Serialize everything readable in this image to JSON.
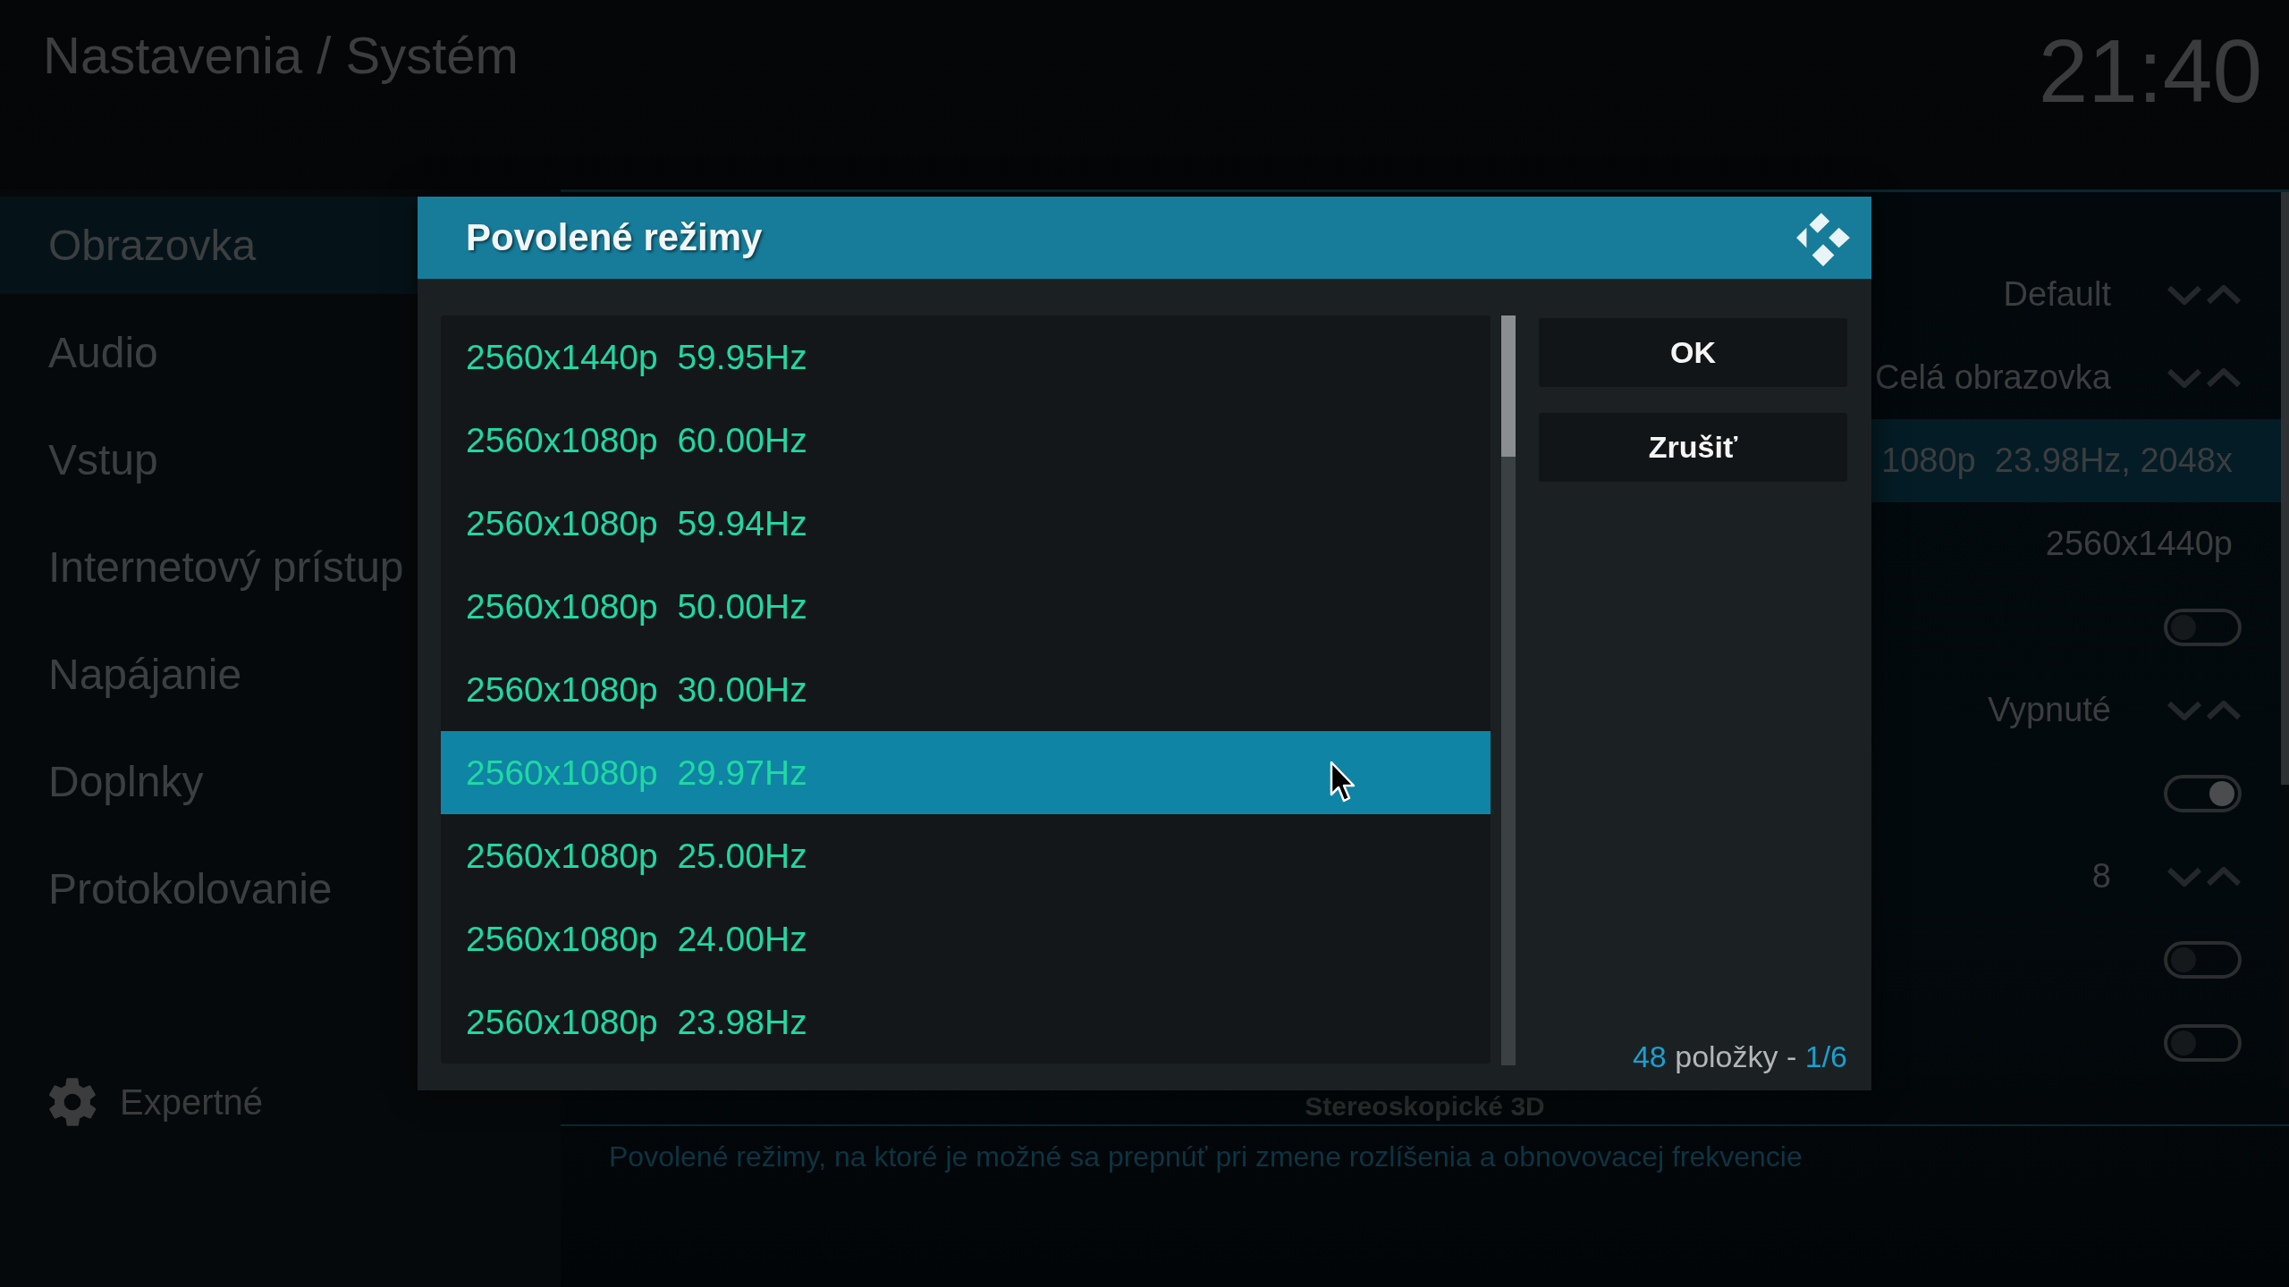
{
  "header": {
    "title": "Nastavenia / Systém",
    "clock": "21:40"
  },
  "sidebar": {
    "items": [
      {
        "label": "Obrazovka",
        "selected": true
      },
      {
        "label": "Audio",
        "selected": false
      },
      {
        "label": "Vstup",
        "selected": false
      },
      {
        "label": "Internetový prístup",
        "selected": false
      },
      {
        "label": "Napájanie",
        "selected": false
      },
      {
        "label": "Doplnky",
        "selected": false
      },
      {
        "label": "Protokolovanie",
        "selected": false
      }
    ],
    "level_button": {
      "label": "Expertné"
    }
  },
  "settings": {
    "rows": [
      {
        "kind": "spinner",
        "value": "Default",
        "selected": false
      },
      {
        "kind": "spinner",
        "value": "Celá obrazovka",
        "selected": false
      },
      {
        "kind": "list",
        "value": "1080p  23.98Hz, 2048x",
        "selected": true
      },
      {
        "kind": "text",
        "value": "2560x1440p",
        "selected": false
      },
      {
        "kind": "toggle",
        "on": false,
        "selected": false
      },
      {
        "kind": "spinner",
        "value": "Vypnuté",
        "selected": false
      },
      {
        "kind": "toggle",
        "on": true,
        "selected": false
      },
      {
        "kind": "spinner",
        "value": "8",
        "selected": false
      },
      {
        "kind": "toggle",
        "on": false,
        "selected": false
      },
      {
        "kind": "toggle",
        "on": false,
        "selected": false
      }
    ],
    "section_heading": "Stereoskopické 3D",
    "description": "Povolené režimy, na ktoré je možné sa prepnúť pri zmene rozlíšenia a obnovovacej frekvencie"
  },
  "dialog": {
    "title": "Povolené režimy",
    "items": [
      {
        "label": "2560x1440p  59.95Hz",
        "selected": false
      },
      {
        "label": "2560x1080p  60.00Hz",
        "selected": false
      },
      {
        "label": "2560x1080p  59.94Hz",
        "selected": false
      },
      {
        "label": "2560x1080p  50.00Hz",
        "selected": false
      },
      {
        "label": "2560x1080p  30.00Hz",
        "selected": false
      },
      {
        "label": "2560x1080p  29.97Hz",
        "selected": true
      },
      {
        "label": "2560x1080p  25.00Hz",
        "selected": false
      },
      {
        "label": "2560x1080p  24.00Hz",
        "selected": false
      },
      {
        "label": "2560x1080p  23.98Hz",
        "selected": false
      }
    ],
    "buttons": [
      "OK",
      "Zrušiť"
    ],
    "count": "48",
    "count_label": "položky -",
    "page": "1/6"
  }
}
